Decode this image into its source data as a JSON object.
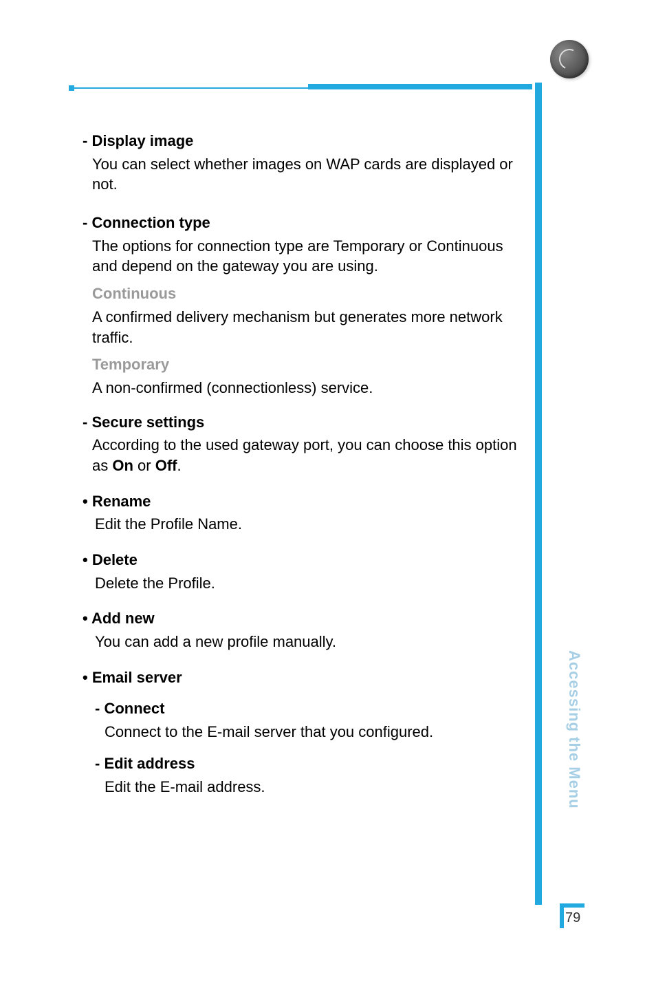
{
  "header_icon": "globe-icon",
  "sections": {
    "display_image": {
      "title": "- Display image",
      "desc": "You can select whether images on WAP cards are displayed or not."
    },
    "connection_type": {
      "title": "- Connection type",
      "desc": "The options for connection type are Temporary or Continuous and depend on the gateway you are using.",
      "continuous_label": "Continuous",
      "continuous_desc": "A confirmed delivery mechanism but generates more network traffic.",
      "temporary_label": "Temporary",
      "temporary_desc": "A non-confirmed (connectionless) service."
    },
    "secure_settings": {
      "title": "- Secure settings",
      "desc_prefix": "According to the used gateway port, you can choose this option as ",
      "on": "On",
      "or": " or ",
      "off": "Off",
      "period": "."
    },
    "rename": {
      "title": "• Rename",
      "desc": "Edit the Profile Name."
    },
    "delete": {
      "title": "• Delete",
      "desc": "Delete the Profile."
    },
    "add_new": {
      "title": "• Add new",
      "desc": "You can add a new profile manually."
    },
    "email_server": {
      "title": "• Email server",
      "connect_title": "- Connect",
      "connect_desc": "Connect to the E-mail server that you configured.",
      "edit_title": "- Edit address",
      "edit_desc": "Edit the E-mail address."
    }
  },
  "side_label": "Accessing the Menu",
  "page_number": "79"
}
